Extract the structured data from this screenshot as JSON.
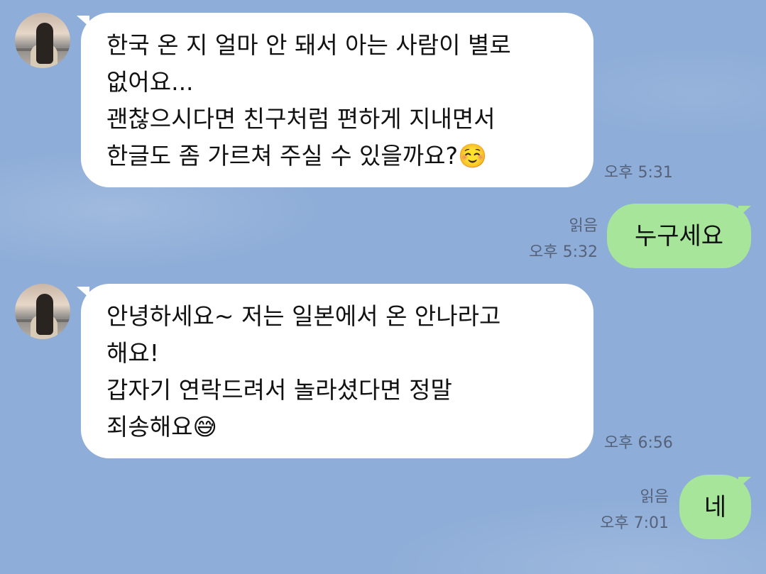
{
  "chat": {
    "messages": [
      {
        "sender": "other",
        "lines": [
          "한국 온 지 얼마 안 돼서 아는 사람이 별로",
          "없어요...",
          "괜찮으시다면 친구처럼 편하게 지내면서",
          "한글도 좀 가르쳐 주실 수 있을까요?"
        ],
        "emoji": "☺️",
        "time": "오후 5:31"
      },
      {
        "sender": "me",
        "text": "누구세요",
        "read": "읽음",
        "time": "오후 5:32"
      },
      {
        "sender": "other",
        "lines": [
          "안녕하세요~ 저는 일본에서 온 안나라고",
          "해요!",
          "갑자기 연락드려서 놀라셨다면 정말",
          "죄송해요"
        ],
        "emoji": "😅",
        "time": "오후 6:56"
      },
      {
        "sender": "me",
        "text": "네",
        "read": "읽음",
        "time": "오후 7:01"
      }
    ]
  }
}
